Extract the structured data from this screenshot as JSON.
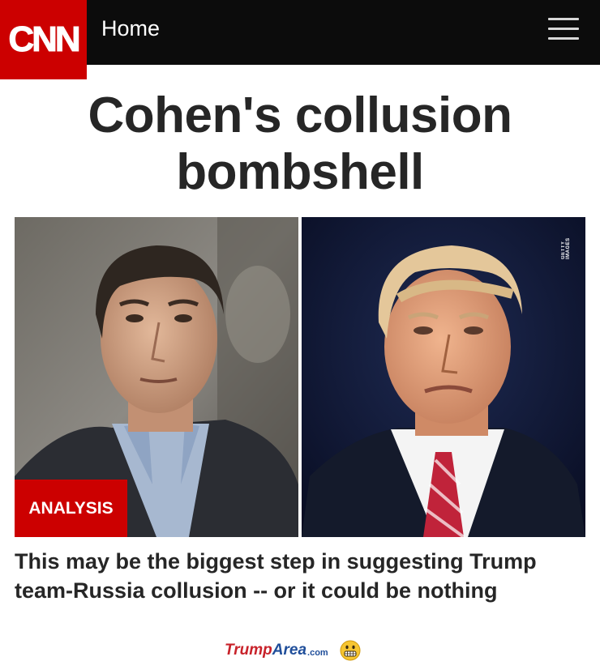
{
  "header": {
    "logo_text": "CNN",
    "section_label": "Home",
    "menu_icon": "hamburger-menu-icon",
    "brand_color": "#cc0000"
  },
  "article": {
    "headline": "Cohen's collusion bombshell",
    "photo_credit": "GETTY IMAGES",
    "badge_label": "ANALYSIS",
    "summary": "This may be the biggest step in suggesting Trump team-Russia collusion -- or it could be nothing"
  },
  "watermark": {
    "brand_part1": "Trump",
    "brand_part2": "Area",
    "brand_suffix": ".com",
    "emoji_icon": "grimace-emoji-icon"
  }
}
